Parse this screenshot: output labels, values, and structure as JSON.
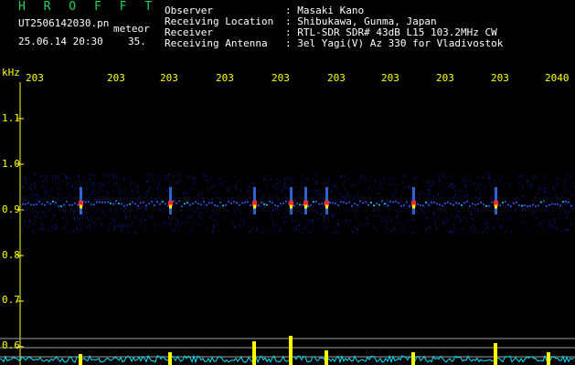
{
  "app_title": "H R O F F T",
  "file_name": "UT2506142030.pn",
  "mode_label": "meteor",
  "datetime": "25.06.14 20:30",
  "frame_value": "35.",
  "header": [
    {
      "label": "Observer",
      "value": ": Masaki Kano"
    },
    {
      "label": "Receiving Location",
      "value": ": Shibukawa, Gunma, Japan"
    },
    {
      "label": "Receiver",
      "value": ": RTL-SDR SDR# 43dB L15 103.2MHz CW"
    },
    {
      "label": "Receiving Antenna",
      "value": ": 3el Yagi(V) Az 330 for Vladivostok"
    }
  ],
  "axis": {
    "y_unit": "kHz",
    "y_ticks": [
      "1.1",
      "1.0",
      "0.9",
      "0.8",
      "0.7",
      "0.6"
    ],
    "x_ticks": [
      "203",
      "203",
      "203",
      "203",
      "203",
      "203",
      "203",
      "203",
      "203",
      "2040"
    ]
  },
  "colors": {
    "background": "#000000",
    "axis_text": "#ffff00",
    "header_text": "#ffffff",
    "title": "#21d05a",
    "band": "#0a1a8c",
    "trace": "#00e5ff",
    "spike": "#ffff00"
  },
  "band_khz": [
    0.85,
    0.98
  ]
}
